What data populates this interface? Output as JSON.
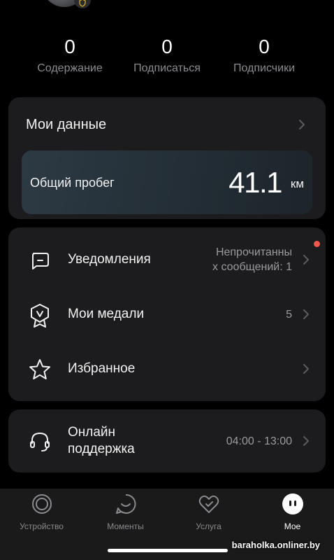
{
  "profile": {
    "stats": [
      {
        "count": "0",
        "label": "Содержание"
      },
      {
        "count": "0",
        "label": "Подписаться"
      },
      {
        "count": "0",
        "label": "Подписчики"
      }
    ]
  },
  "my_data": {
    "title": "Мои данные",
    "mileage_label": "Общий пробег",
    "mileage_value": "41.1",
    "mileage_unit": "км"
  },
  "menu": {
    "notifications": {
      "label": "Уведомления",
      "value_line1": "Непрочитанны",
      "value_line2": "х сообщений: 1",
      "icon": "message-icon"
    },
    "medals": {
      "label": "Мои медали",
      "value": "5",
      "icon": "medal-icon"
    },
    "favorites": {
      "label": "Избранное",
      "icon": "star-icon"
    }
  },
  "support": {
    "label_line1": "Онлайн",
    "label_line2": "поддержка",
    "hours": "04:00 - 13:00",
    "icon": "headset-icon"
  },
  "tabbar": [
    {
      "label": "Устройство",
      "icon": "device-icon"
    },
    {
      "label": "Моменты",
      "icon": "moments-icon"
    },
    {
      "label": "Услуга",
      "icon": "heart-icon"
    },
    {
      "label": "Мое",
      "icon": "profile-face-icon"
    }
  ],
  "watermark": "baraholka.onliner.by",
  "colors": {
    "background": "#000000",
    "card": "#1c1c1e",
    "secondary_text": "#8b8b90",
    "notification_dot": "#f0564a"
  }
}
